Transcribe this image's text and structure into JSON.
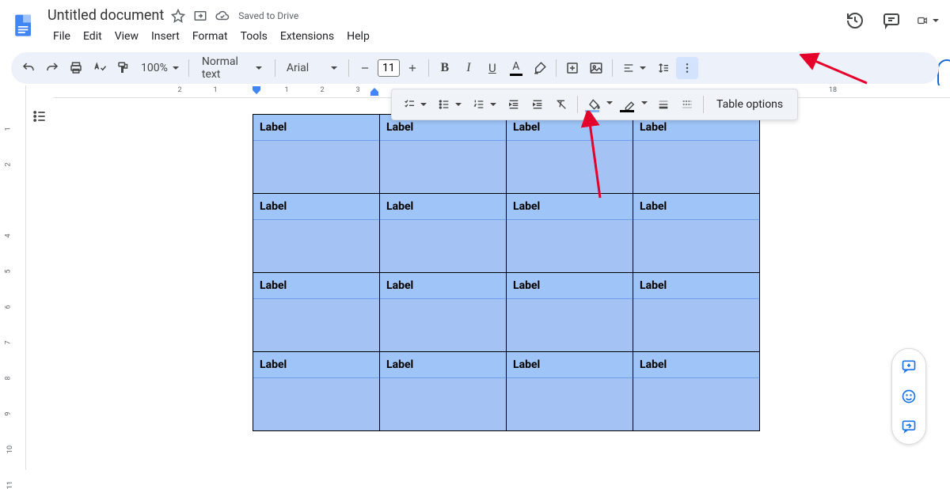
{
  "header": {
    "title": "Untitled document",
    "saved": "Saved to Drive",
    "menus": [
      "File",
      "Edit",
      "View",
      "Insert",
      "Format",
      "Tools",
      "Extensions",
      "Help"
    ]
  },
  "toolbar": {
    "zoom": "100%",
    "style": "Normal text",
    "font": "Arial",
    "fontsize": "11"
  },
  "sec_toolbar": {
    "table_options": "Table options"
  },
  "table": {
    "label": "Label",
    "rows": 4,
    "cols": 4
  },
  "ruler": {
    "h": [
      "2",
      "1",
      "",
      "1",
      "2",
      "3"
    ],
    "h_right": [
      "18"
    ],
    "v": [
      "1",
      "2",
      "",
      "4",
      "5",
      "6",
      "7",
      "8",
      "9",
      "10",
      "11"
    ]
  }
}
